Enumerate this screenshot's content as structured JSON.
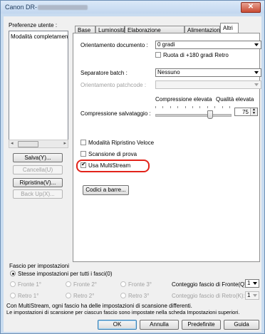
{
  "window": {
    "title": "Canon DR-",
    "close_glyph": "✕"
  },
  "left": {
    "preferences_label": "Preferenze utente :",
    "list_item": "Modalità completament",
    "save_button": "Salva(Y)...",
    "delete_button": "Cancella(U)",
    "restore_button": "Ripristina(V)...",
    "backup_button": "Back Up(X)..."
  },
  "tabs": [
    {
      "label": "Base"
    },
    {
      "label": "Luminosità"
    },
    {
      "label": "Elaborazione immagine"
    },
    {
      "label": "Alimentazione"
    },
    {
      "label": "Altri"
    }
  ],
  "panel": {
    "orientation_label": "Orientamento documento :",
    "orientation_value": "0 gradi",
    "rotate_label": "Ruota di +180 gradi Retro",
    "batch_label": "Separatore batch :",
    "batch_value": "Nessuno",
    "patchcode_label": "Orientamento patchcode :",
    "patchcode_value": "",
    "compression_high": "Compressione elevata",
    "quality_high": "Qualità elevata",
    "compression_label": "Compressione salvataggio :",
    "compression_value": "75",
    "compression_level": 75,
    "rapid_recovery_label": "Modalità Ripristino Veloce",
    "test_scan_label": "Scansione di prova",
    "multistream_label": "Usa MultiStream",
    "multistream_checked": true,
    "barcode_button": "Codici a barre..."
  },
  "batch_section": {
    "title": "Fascio per impostazioni",
    "same_settings_label": "Stesse impostazioni per tutti i fasci(0)",
    "front1": "Fronte 1°",
    "front2": "Fronte 2°",
    "front3": "Fronte 3°",
    "back1": "Retro 1°",
    "back2": "Retro 2°",
    "back3": "Retro 3°",
    "front_count_label": "Conteggio fascio di Fronte(Q):",
    "front_count_value": "1",
    "back_count_label": "Conteggio fascio di Retro(K):",
    "back_count_value": "1"
  },
  "info": {
    "line1": "Con MultiStream, ogni fascio ha delle impostazioni di scansione differenti.",
    "line2": "Le impostazioni di scansione per ciascun fascio sono impostate nella scheda Impostazioni superiori."
  },
  "buttons": {
    "ok": "OK",
    "cancel": "Annulla",
    "defaults": "Predefinite",
    "help": "Guida"
  },
  "colors": {
    "highlight": "#e2231a",
    "window_frame": "#c9dcf0"
  }
}
